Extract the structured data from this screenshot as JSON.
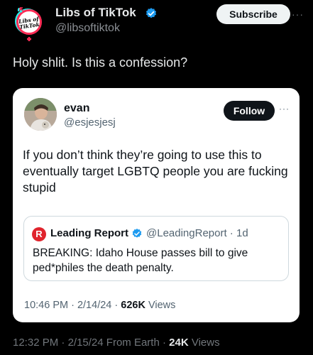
{
  "author": {
    "name": "Libs of TikTok",
    "handle": "@libsoftiktok",
    "avatar_text": "Libs of TikTok",
    "subscribe_label": "Subscribe",
    "more_icon": "···"
  },
  "tweet": {
    "text": "Holy shlit. Is this a confession?",
    "time": "12:32 PM",
    "date": "2/15/24",
    "source": "From Earth",
    "views_count": "24K",
    "views_label": "Views"
  },
  "quoted": {
    "name": "evan",
    "handle": "@esjesjesj",
    "follow_label": "Follow",
    "more_icon": "···",
    "text": "If you don’t think they’re going to use this to eventually target LGBTQ people you are fucking stupid",
    "time": "10:46 PM",
    "date": "2/14/24",
    "views_count": "626K",
    "views_label": "Views"
  },
  "nested_quote": {
    "logo_letter": "R",
    "name": "Leading Report",
    "handle": "@LeadingReport",
    "age": "1d",
    "text": "BREAKING: Idaho House passes bill to give ped*philes the death penalty."
  },
  "colors": {
    "background": "#000000",
    "card": "#ffffff",
    "verified": "#1d9bf0",
    "logo_red": "#e0242d"
  }
}
